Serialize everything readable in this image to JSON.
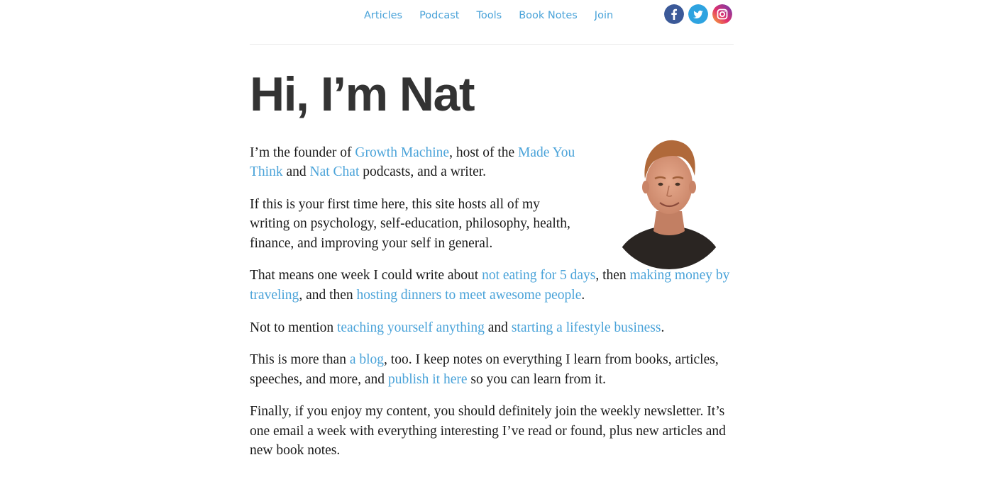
{
  "nav": {
    "articles": "Articles",
    "podcast": "Podcast",
    "tools": "Tools",
    "book_notes": "Book Notes",
    "join": "Join"
  },
  "social": {
    "icons": [
      "facebook-icon",
      "twitter-icon",
      "instagram-icon"
    ],
    "colors": {
      "facebook": "#3b5998",
      "twitter": "#2ea3e0",
      "instagram": "#c13584"
    }
  },
  "heading": "Hi, I’m Nat",
  "colors": {
    "link": "#4aa3d9",
    "heading": "#333333",
    "text": "#1a1a1a"
  },
  "p1": {
    "t1": "I’m the founder of ",
    "l1": "Growth Machine",
    "t2": ", host of the ",
    "l2": "Made You Think",
    "t3": " and ",
    "l3": "Nat Chat",
    "t4": " podcasts, and a writer."
  },
  "p2": {
    "t1": "If this is your first time here, this site hosts all of my writing on psychology, self-education, philosophy, health, finance, and improving your self in general."
  },
  "p3": {
    "t1": "That means one week I could write about ",
    "l1": "not eating for 5 days",
    "t2": ", then ",
    "l2": "making money by traveling",
    "t3": ", and then ",
    "l3": "hosting dinners to meet awesome people",
    "t4": "."
  },
  "p4": {
    "t1": "Not to mention ",
    "l1": "teaching yourself anything",
    "t2": " and ",
    "l2": "starting a lifestyle business",
    "t3": "."
  },
  "p5": {
    "t1": "This is more than ",
    "l1": "a blog",
    "t2": ", too. I keep notes on everything I learn from books, arti­cles, speeches, and more, and ",
    "l2": "publish it here",
    "t3": " so you can learn from it."
  },
  "p6": {
    "t1": "Finally, if you enjoy my content, you should definitely join the weekly newsletter. It’s one email a week with everything interesting I’ve read or found, plus new arti­cles and new book notes."
  }
}
